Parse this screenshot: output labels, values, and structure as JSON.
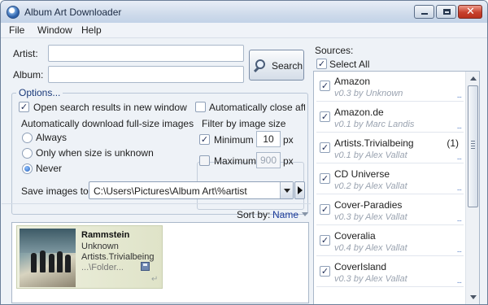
{
  "window": {
    "title": "Album Art Downloader"
  },
  "menu": [
    "File",
    "Window",
    "Help"
  ],
  "search": {
    "artist_label": "Artist:",
    "artist_value": "",
    "album_label": "Album:",
    "album_value": "",
    "button_label": "Search"
  },
  "options": {
    "title": "Options...",
    "open_results_new_window": {
      "label": "Open search results in new window",
      "checked": true
    },
    "auto_close": {
      "label": "Automatically close afte",
      "checked": false
    },
    "auto_download_label": "Automatically download full-size images",
    "radios": [
      {
        "label": "Always",
        "selected": false
      },
      {
        "label": "Only when size is unknown",
        "selected": false
      },
      {
        "label": "Never",
        "selected": true
      }
    ],
    "filter": {
      "title": "Filter by image size",
      "minimum": {
        "label": "Minimum",
        "value": "10",
        "unit": "px",
        "checked": true
      },
      "maximum": {
        "label": "Maximum",
        "value": "900",
        "unit": "px",
        "checked": false
      }
    },
    "save_images_label": "Save images to:",
    "save_path": "C:\\Users\\Pictures\\Album Art\\%artist"
  },
  "sort": {
    "label": "Sort by:",
    "value": "Name"
  },
  "results": [
    {
      "artist": "Rammstein",
      "album": "Unknown",
      "source": "Artists.Trivialbeing",
      "folder": "...\\Folder..."
    }
  ],
  "sources": {
    "label": "Sources:",
    "select_all": {
      "label": "Select All",
      "checked": true
    },
    "items": [
      {
        "name": "Amazon",
        "version": "v0.3 by Unknown",
        "count": "",
        "checked": true
      },
      {
        "name": "Amazon.de",
        "version": "v0.1 by Marc Landis",
        "count": "",
        "checked": true
      },
      {
        "name": "Artists.Trivialbeing",
        "version": "v0.1 by Alex Vallat",
        "count": "(1)",
        "checked": true
      },
      {
        "name": "CD Universe",
        "version": "v0.2 by Alex Vallat",
        "count": "",
        "checked": true
      },
      {
        "name": "Cover-Paradies",
        "version": "v0.3 by Alex Vallat",
        "count": "",
        "checked": true
      },
      {
        "name": "Coveralia",
        "version": "v0.4 by Alex Vallat",
        "count": "",
        "checked": true
      },
      {
        "name": "CoverIsland",
        "version": "v0.3 by Alex Vallat",
        "count": "",
        "checked": true
      }
    ],
    "more_glyph": "..."
  }
}
